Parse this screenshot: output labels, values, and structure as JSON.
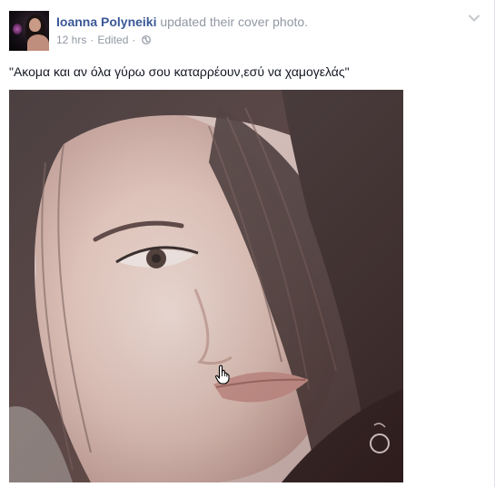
{
  "post": {
    "author_name": "Ioanna Polyneiki",
    "action_text": "updated their cover photo.",
    "time": "12 hrs",
    "edited_label": "Edited",
    "separator": "·",
    "privacy_icon": "globe-icon",
    "options_icon": "chevron-down-icon",
    "caption": "\"Ακομα και αν όλα γύρω σου καταρρέουν,εσύ να χαμογελάς\""
  },
  "colors": {
    "name_link": "#3b5998",
    "meta_text": "#9197a3",
    "body_text": "#141823"
  },
  "overlay": {
    "pointer_icon": "hand-pointer-icon"
  }
}
